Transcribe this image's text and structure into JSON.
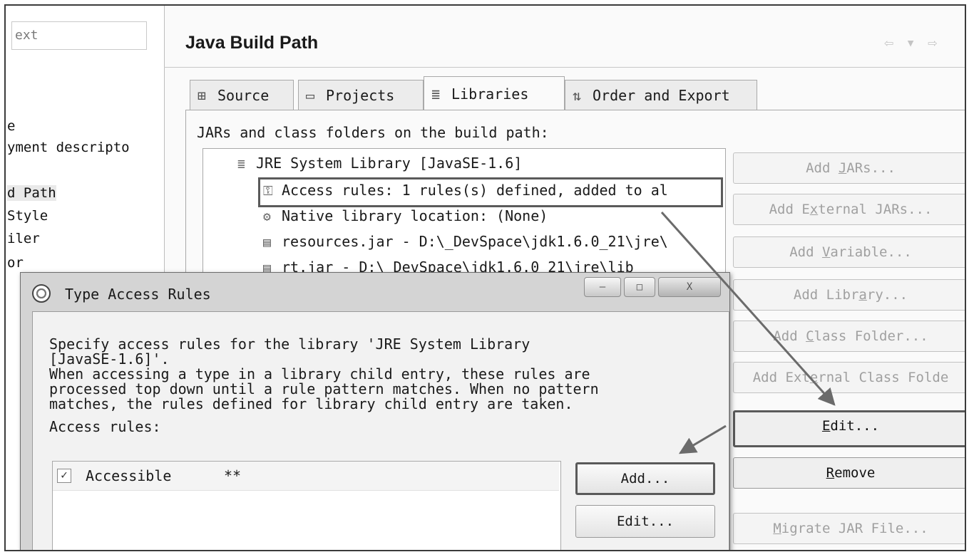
{
  "left_nav": {
    "filter_text": "ext",
    "items": [
      "e",
      "yment descripto",
      "d Path",
      " Style",
      "iler",
      "or"
    ]
  },
  "header": {
    "title": "Java Build Path",
    "nav_arrows": "⇦ ▾ ⇨"
  },
  "tabs": [
    {
      "label": "Source",
      "icon": "source-folder-icon"
    },
    {
      "label": "Projects",
      "icon": "projects-folder-icon"
    },
    {
      "label": "Libraries",
      "icon": "libraries-icon",
      "active": true
    },
    {
      "label": "Order and Export",
      "icon": "order-export-icon"
    }
  ],
  "panel_label": "JARs and class folders on the build path:",
  "tree": {
    "items": [
      {
        "text": "JRE System Library [JavaSE-1.6]",
        "icon": "library-icon"
      },
      {
        "text": "Access rules: 1 rules(s) defined, added to al",
        "icon": "access-rules-icon"
      },
      {
        "text": "Native library location: (None)",
        "icon": "native-library-icon"
      },
      {
        "text": "resources.jar - D:\\_DevSpace\\jdk1.6.0_21\\jre\\",
        "icon": "jar-icon"
      },
      {
        "text": "rt.jar - D:\\_DevSpace\\jdk1.6.0_21\\jre\\lib",
        "icon": "jar-icon"
      }
    ]
  },
  "right_buttons": {
    "add_jars": {
      "pre": "Add ",
      "u": "J",
      "post": "ARs..."
    },
    "add_external_jars": {
      "pre": "Add E",
      "u": "x",
      "post": "ternal JARs..."
    },
    "add_variable": {
      "pre": "Add ",
      "u": "V",
      "post": "ariable..."
    },
    "add_library": {
      "pre": "Add Libr",
      "u": "a",
      "post": "ry..."
    },
    "add_class_folder": {
      "pre": "Add ",
      "u": "C",
      "post": "lass Folder..."
    },
    "add_external_class_folder": {
      "pre": "Add Ext",
      "u": "e",
      "post": "rnal Class Folde"
    },
    "edit": {
      "pre": "",
      "u": "E",
      "post": "dit..."
    },
    "remove": {
      "pre": "",
      "u": "R",
      "post": "emove"
    },
    "migrate": {
      "pre": "",
      "u": "M",
      "post": "igrate JAR File..."
    }
  },
  "dialog": {
    "title": "Type Access Rules",
    "window_buttons": {
      "minimize": "—",
      "maximize": "□",
      "close": "X"
    },
    "description": "Specify access rules for the library 'JRE System Library\n[JavaSE-1.6]'.\nWhen accessing a type in a library child entry, these rules are\nprocessed top down until a rule pattern matches. When no pattern\nmatches, the rules defined for library child entry are taken.",
    "access_rules_label": "Access rules:",
    "rules": [
      {
        "kind": "Accessible",
        "pattern": "**"
      }
    ],
    "add_button": "Add...",
    "edit_button": "Edit..."
  },
  "colors": {
    "highlight_border": "#5a5a5a",
    "panel_bg": "#fafafa",
    "dialog_chrome": "#d4d4d4"
  }
}
